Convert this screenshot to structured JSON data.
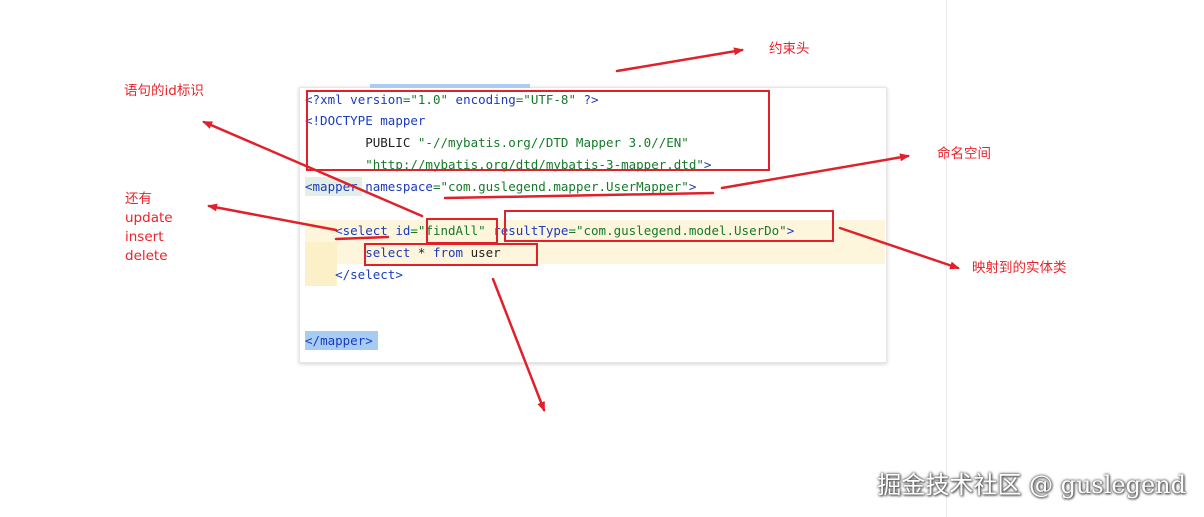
{
  "code": {
    "lines": [
      [
        {
          "t": "<?",
          "c": "tg"
        },
        {
          "t": "xml ",
          "c": "tg"
        },
        {
          "t": "version",
          "c": "at"
        },
        {
          "t": "=\"1.0\" ",
          "c": "st"
        },
        {
          "t": "encoding",
          "c": "at"
        },
        {
          "t": "=\"UTF-8\" ",
          "c": "st"
        },
        {
          "t": "?>",
          "c": "tg"
        }
      ],
      [
        {
          "t": "<!DOCTYPE ",
          "c": "tg"
        },
        {
          "t": "mapper",
          "c": "tg"
        }
      ],
      [
        {
          "t": "        PUBLIC ",
          "c": "pl"
        },
        {
          "t": "\"-//mybatis.org//DTD Mapper 3.0//EN\"",
          "c": "st"
        }
      ],
      [
        {
          "t": "        ",
          "c": "pl"
        },
        {
          "t": "\"http://mybatis.org/dtd/mybatis-3-mapper.dtd\"",
          "c": "st"
        },
        {
          "t": ">",
          "c": "tg"
        }
      ],
      [
        {
          "t": "<",
          "c": "tg"
        },
        {
          "t": "mapper ",
          "c": "tg"
        },
        {
          "t": "namespace",
          "c": "at"
        },
        {
          "t": "=\"com.guslegend.mapper.UserMapper\"",
          "c": "st"
        },
        {
          "t": ">",
          "c": "tg"
        }
      ],
      [],
      [
        {
          "t": "    <",
          "c": "tg"
        },
        {
          "t": "select ",
          "c": "tg"
        },
        {
          "t": "id",
          "c": "at"
        },
        {
          "t": "=\"findAll\" ",
          "c": "st"
        },
        {
          "t": "resultType",
          "c": "at"
        },
        {
          "t": "=\"com.guslegend.model.UserDo\"",
          "c": "st"
        },
        {
          "t": ">",
          "c": "tg"
        }
      ],
      [
        {
          "t": "        ",
          "c": "pl"
        },
        {
          "t": "select ",
          "c": "kw"
        },
        {
          "t": "* ",
          "c": "pl"
        },
        {
          "t": "from ",
          "c": "kw"
        },
        {
          "t": "user",
          "c": "pl"
        }
      ],
      [
        {
          "t": "    </",
          "c": "tg"
        },
        {
          "t": "select",
          "c": "tg"
        },
        {
          "t": ">",
          "c": "tg"
        }
      ],
      [],
      [],
      [
        {
          "t": "</",
          "c": "tg"
        },
        {
          "t": "mapper",
          "c": "tg"
        },
        {
          "t": ">",
          "c": "tg"
        }
      ]
    ]
  },
  "annotations": {
    "constraint_header": "约束头",
    "statement_id": "语句的id标识",
    "namespace": "命名空间",
    "also": [
      "还有",
      "update",
      "insert",
      "delete"
    ],
    "mapped_entity": "映射到的实体类"
  },
  "watermark": "掘金技术社区 @ guslegend",
  "colors": {
    "annotation_red": "#e8242b",
    "tag_blue": "#1c3bbd",
    "string_green": "#167a2b",
    "line_highlight": "#fdf6dc",
    "mapper_highlight": "#a6cdf1"
  }
}
